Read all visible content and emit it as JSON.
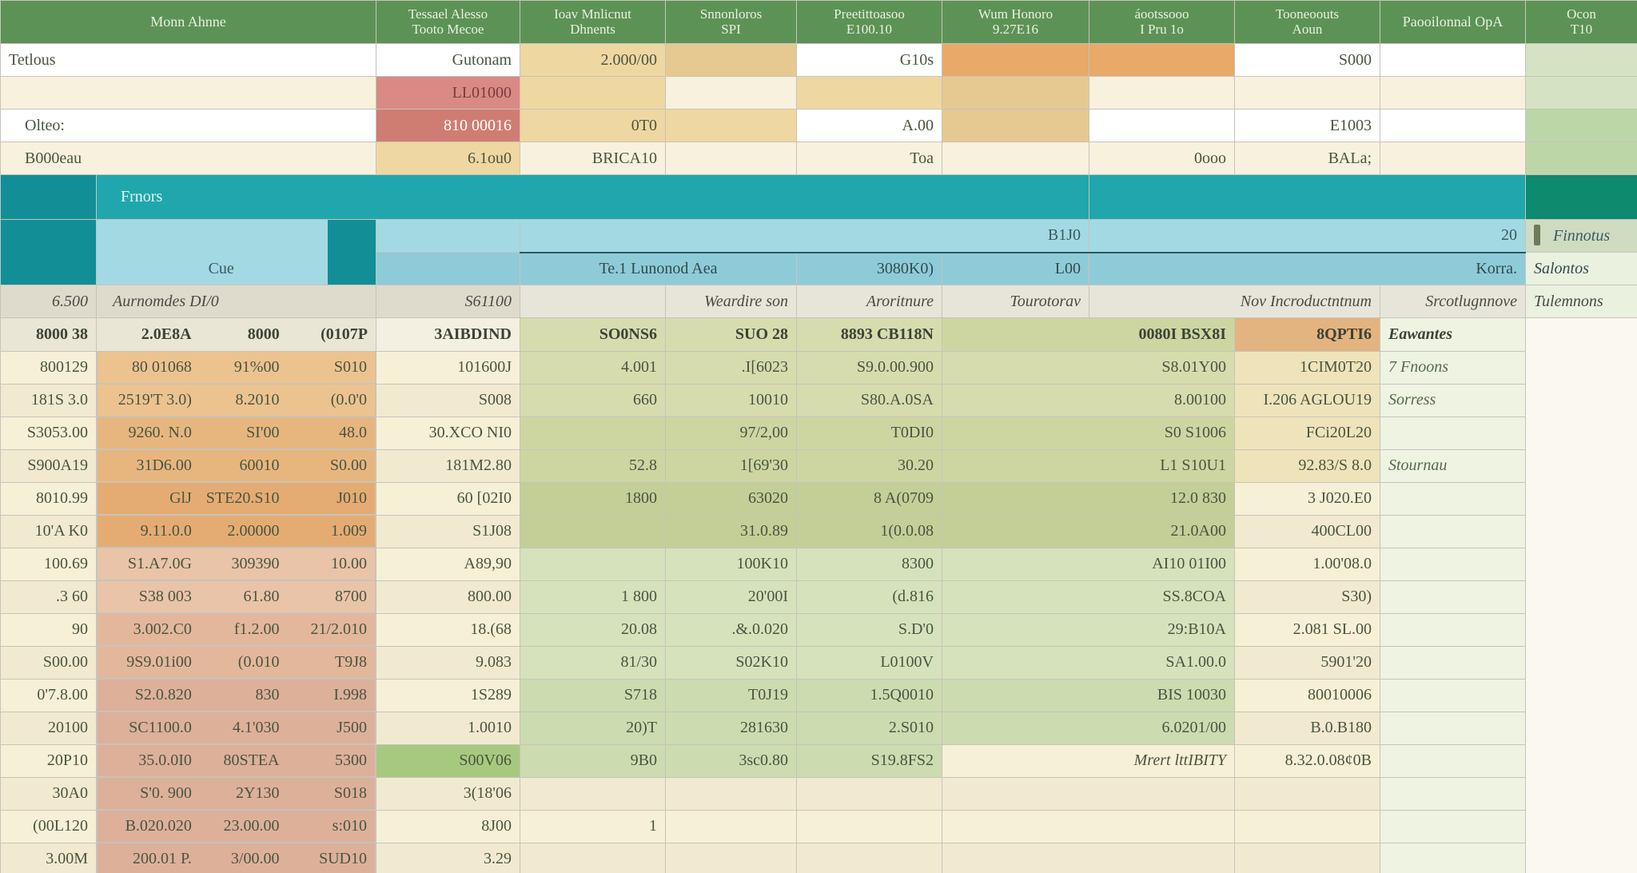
{
  "header": {
    "c1": "Monn   Ahnne",
    "c2a": "Tessael Alesso",
    "c2b": "Tooto Mecoe",
    "c3a": "Ioav Mnlicnut",
    "c3b": "Dhnents",
    "c4a": "Snnonloros",
    "c4b": "SPI",
    "c5a": "Preetittoasoo",
    "c5b": "E100.10",
    "c6a": "Wum Honoro",
    "c6b": "9.27E16",
    "c7a": "áootssooo",
    "c7b": "I Pru 1o",
    "c8a": "Tooneoouts",
    "c8b": "Aoun",
    "c9": "Paooilonnal OpA",
    "c10a": "Ocon",
    "c10b": "T10"
  },
  "sum": {
    "r1": {
      "label": "Tetlous",
      "c2": "Gutonam",
      "c3": "2.000/00",
      "c5": "G10s",
      "c8": "S000"
    },
    "r2": {
      "c2": "LL01000"
    },
    "r3": {
      "label": "Olteo:",
      "c2": "810 00016",
      "c3": "0T0",
      "c5": "A.00",
      "c8": "E1003"
    },
    "r4": {
      "label": "B000eau",
      "c2": "6.1ou0",
      "c3": "BRICA10",
      "c5": "Toa",
      "c7": "0ooo",
      "c8": "BALa;"
    }
  },
  "teal": {
    "label": "Frnors",
    "sub": {
      "cue": "Cue",
      "mid": "Te.1 Lunonod Aea",
      "v1": "B1J0",
      "v2": "3080K0)",
      "v3": "L00",
      "r": "Korra.",
      "re": "20",
      "p1": "Finnotus",
      "p2": "Salontos"
    }
  },
  "subheader": {
    "c1": "6.500",
    "c2": "Aurnomdes DI/0",
    "c3": "S61100",
    "c5": "Weardire son",
    "c6": "Aroritnure",
    "c7": "Tourotorav",
    "c8": "Nov Incroductntnum",
    "c9": "Srcotlugnnove",
    "s": "Tulemnons"
  },
  "cat": {
    "c1": "8000 38",
    "a": "2.0E8A",
    "b": "8000",
    "c": "(0107P",
    "d": "3AIBDIND",
    "e": "SO0NS6",
    "f": "SUO 28",
    "g": "8893 CB118N",
    "h": "0080I BSX8I",
    "i": "8QPTI6",
    "s": "Eawantes"
  },
  "rows": [
    {
      "c1": "800129",
      "a": "80 01068",
      "b": "91%00",
      "c": "S010",
      "d": "101600J",
      "e": "4.001",
      "f": ".I[6023",
      "g": "S9.0.00.900",
      "h": "S8.01Y00",
      "i": "1CIM0T20",
      "s": "7 Fnoons"
    },
    {
      "c1": "181S 3.0",
      "a": "2519'T 3.0)",
      "b": "8.2010",
      "c": "(0.0'0",
      "d": "S008",
      "e": "660",
      "f": "10010",
      "g": "S80.A.0SA",
      "h": "8.00100",
      "i": "I.206 AGLOU19",
      "s": "Sorress"
    },
    {
      "c1": "S3053.00",
      "a": "9260. N.0",
      "b": "SI'00",
      "c": "48.0",
      "d": "30.XCO NI0",
      "e": "",
      "f": "97/2,00",
      "g": "T0DI0",
      "h": "S0 S1006",
      "i": "FCi20L20",
      "s": ""
    },
    {
      "c1": "S900A19",
      "a": "31D6.00",
      "b": "60010",
      "c": "S0.00",
      "d": "181M2.80",
      "e": "52.8",
      "f": "1[69'30",
      "g": "30.20",
      "h": "L1 S10U1",
      "i": "92.83/S 8.0",
      "s": "Stournau"
    },
    {
      "c1": "8010.99",
      "a": "GlJ",
      "b": "STE20.S10",
      "c": "J010",
      "d": "60 [02I0",
      "e": "1800",
      "f": "63020",
      "g": "8 A(0709",
      "h": "12.0 830",
      "i": "3 J020.E0",
      "s": ""
    },
    {
      "c1": "10'A K0",
      "a": "9.11.0.0",
      "b": "2.00000",
      "c": "1.009",
      "d": "S1J08",
      "e": "",
      "f": "31.0.89",
      "g": "1(0.0.08",
      "h": "21.0A00",
      "i": "400CL00",
      "s": ""
    },
    {
      "c1": "100.69",
      "a": "S1.A7.0G",
      "b": "309390",
      "c": "10.00",
      "d": "A89,90",
      "e": "",
      "f": "100K10",
      "g": "8300",
      "h": "AI10 01I00",
      "i": "1.00'08.0",
      "s": ""
    },
    {
      "c1": ".3 60",
      "a": "S38 003",
      "b": "61.80",
      "c": "8700",
      "d": "800.00",
      "e": "1 800",
      "f": "20'00I",
      "g": "(d.816",
      "h": "SS.8COA",
      "i": "S30)",
      "s": ""
    },
    {
      "c1": "90",
      "a": "3.002.C0",
      "b": "f1.2.00",
      "c": "21/2.010",
      "d": "18.(68",
      "e": "20.08",
      "f": ".&.0.020",
      "g": "S.D'0",
      "h": "29:B10A",
      "i": "2.081 SL.00",
      "s": ""
    },
    {
      "c1": "S00.00",
      "a": "9S9.01i00",
      "b": "(0.010",
      "c": "T9J8",
      "d": "9.083",
      "e": "81/30",
      "f": "S02K10",
      "g": "L0100V",
      "h": "SA1.00.0",
      "i": "5901'20",
      "s": ""
    },
    {
      "c1": "0'7.8.00",
      "a": "S2.0.820",
      "b": "830",
      "c": "I.998",
      "d": "1S289",
      "e": "S718",
      "f": "T0J19",
      "g": "1.5Q0010",
      "h": "BIS 10030",
      "i": "80010006",
      "s": ""
    },
    {
      "c1": "20100",
      "a": "SC1100.0",
      "b": "4.1'030",
      "c": "J500",
      "d": "1.0010",
      "e": "20)T",
      "f": "281630",
      "g": "2.S010",
      "h": "6.0201/00",
      "i": "B.0.B180",
      "s": ""
    },
    {
      "c1": "20P10",
      "a": "35.0.0I0",
      "b": "80STEA",
      "c": "5300",
      "d": "S00V06",
      "e": "9B0",
      "f": "3sc0.80",
      "g": "S19.8FS2",
      "h": "Mrert lttIBITY",
      "i": "8.32.0.08¢0B",
      "s": ""
    },
    {
      "c1": "30A0",
      "a": "S'0. 900",
      "b": "2Y130",
      "c": "S018",
      "d": "3(18'06",
      "e": "",
      "f": "",
      "g": "",
      "h": "",
      "i": "",
      "s": ""
    },
    {
      "c1": "(00L120",
      "a": "B.020.020",
      "b": "23.00.00",
      "c": "s:010",
      "d": "8J00",
      "e": "1",
      "f": "",
      "g": "",
      "h": "",
      "i": "",
      "s": ""
    },
    {
      "c1": "3.00M",
      "a": "200.01 P.",
      "b": "3/00.00",
      "c": "SUD10",
      "d": "3.29",
      "e": "",
      "f": "",
      "g": "",
      "h": "",
      "i": "",
      "s": ""
    }
  ]
}
